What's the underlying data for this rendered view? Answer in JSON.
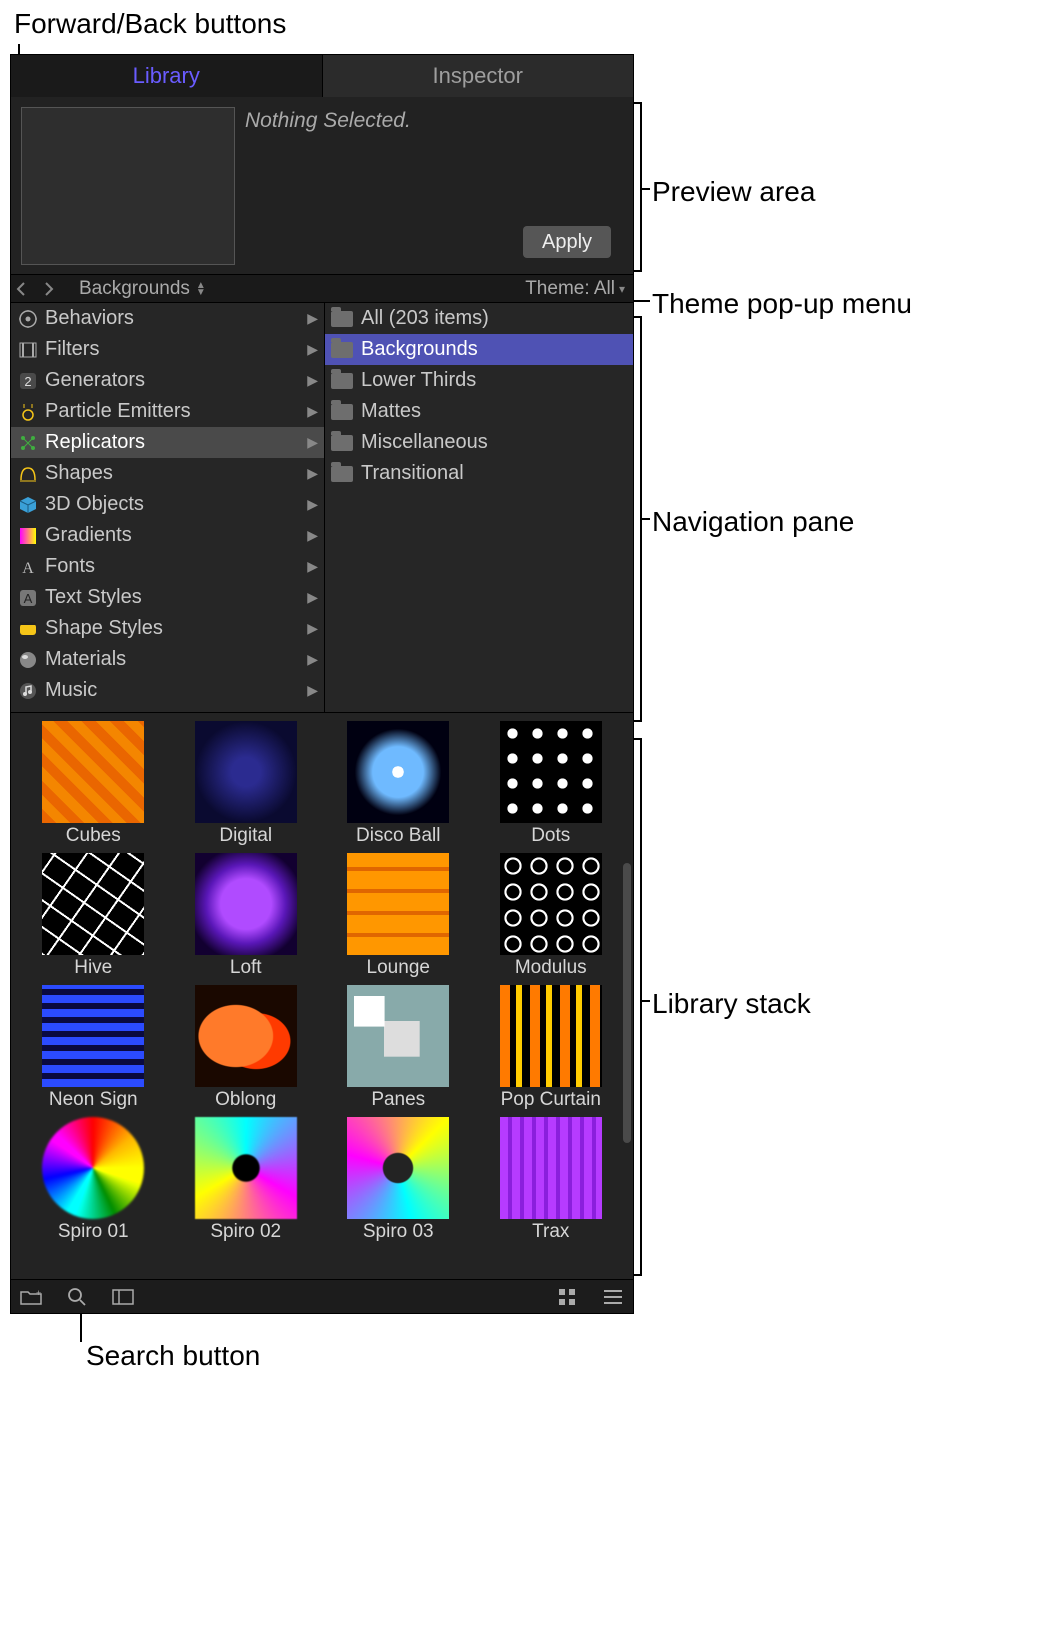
{
  "annotations": {
    "forward_back": "Forward/Back buttons",
    "preview_area": "Preview area",
    "theme_popup": "Theme pop-up menu",
    "navigation_pane": "Navigation pane",
    "library_stack": "Library stack",
    "search_button": "Search button"
  },
  "tabs": {
    "library": "Library",
    "inspector": "Inspector"
  },
  "preview": {
    "status": "Nothing Selected.",
    "apply": "Apply"
  },
  "navbar": {
    "path_label": "Backgrounds",
    "theme_label": "Theme: All"
  },
  "categories": [
    {
      "label": "Behaviors"
    },
    {
      "label": "Filters"
    },
    {
      "label": "Generators"
    },
    {
      "label": "Particle Emitters"
    },
    {
      "label": "Replicators",
      "highlight": true
    },
    {
      "label": "Shapes"
    },
    {
      "label": "3D Objects"
    },
    {
      "label": "Gradients"
    },
    {
      "label": "Fonts"
    },
    {
      "label": "Text Styles"
    },
    {
      "label": "Shape Styles"
    },
    {
      "label": "Materials"
    },
    {
      "label": "Music"
    }
  ],
  "subcategories": [
    {
      "label": "All (203 items)"
    },
    {
      "label": "Backgrounds",
      "selected": true
    },
    {
      "label": "Lower Thirds"
    },
    {
      "label": "Mattes"
    },
    {
      "label": "Miscellaneous"
    },
    {
      "label": "Transitional"
    }
  ],
  "items": [
    {
      "label": "Cubes",
      "sw": "sw-cubes"
    },
    {
      "label": "Digital",
      "sw": "sw-digital"
    },
    {
      "label": "Disco Ball",
      "sw": "sw-disco"
    },
    {
      "label": "Dots",
      "sw": "sw-dots"
    },
    {
      "label": "Hive",
      "sw": "sw-hive"
    },
    {
      "label": "Loft",
      "sw": "sw-loft"
    },
    {
      "label": "Lounge",
      "sw": "sw-lounge"
    },
    {
      "label": "Modulus",
      "sw": "sw-modulus"
    },
    {
      "label": "Neon Sign",
      "sw": "sw-neon"
    },
    {
      "label": "Oblong",
      "sw": "sw-oblong"
    },
    {
      "label": "Panes",
      "sw": "sw-panes"
    },
    {
      "label": "Pop Curtain",
      "sw": "sw-pop"
    },
    {
      "label": "Spiro 01",
      "sw": "sw-sp1"
    },
    {
      "label": "Spiro 02",
      "sw": "sw-sp2"
    },
    {
      "label": "Spiro 03",
      "sw": "sw-sp3"
    },
    {
      "label": "Trax",
      "sw": "sw-trax"
    }
  ]
}
